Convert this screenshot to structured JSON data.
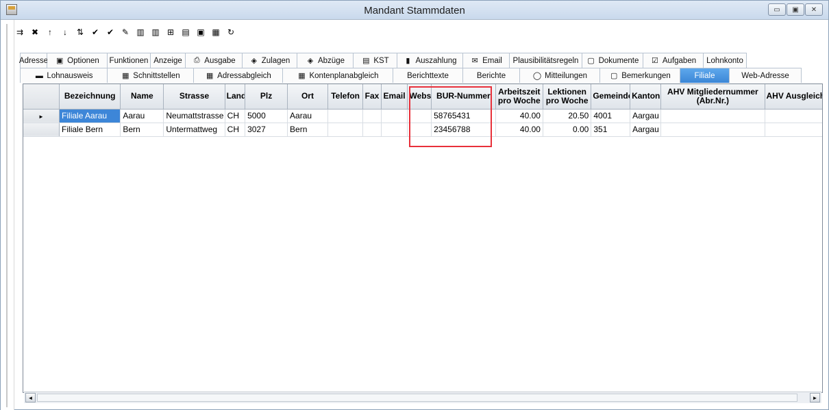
{
  "window": {
    "title": "Mandant Stammdaten"
  },
  "window_buttons": [
    "▭",
    "▣",
    "✕"
  ],
  "toolbar_icons": [
    {
      "name": "insert-row-icon",
      "glyph": "⇉"
    },
    {
      "name": "delete-row-icon",
      "glyph": "✖"
    },
    {
      "name": "arrow-up-icon",
      "glyph": "↑"
    },
    {
      "name": "arrow-down-icon",
      "glyph": "↓"
    },
    {
      "name": "sort-az-icon",
      "glyph": "⇅"
    },
    {
      "name": "spellcheck-icon",
      "glyph": "✔"
    },
    {
      "name": "spellcheck-all-icon",
      "glyph": "✔"
    },
    {
      "name": "edit-icon",
      "glyph": "✎"
    },
    {
      "name": "columns-icon",
      "glyph": "▥"
    },
    {
      "name": "columns2-icon",
      "glyph": "▥"
    },
    {
      "name": "merge-icon",
      "glyph": "⊞"
    },
    {
      "name": "import-icon",
      "glyph": "▤"
    },
    {
      "name": "save-icon",
      "glyph": "▣"
    },
    {
      "name": "copy-icon",
      "glyph": "▦"
    },
    {
      "name": "refresh-icon",
      "glyph": "↻"
    }
  ],
  "tabs_row1": [
    {
      "label": "Adresse",
      "icon": "",
      "w": 40
    },
    {
      "label": "Optionen",
      "icon": "▣",
      "w": 88
    },
    {
      "label": "Funktionen",
      "icon": "",
      "w": 63
    },
    {
      "label": "Anzeige",
      "icon": "",
      "w": 51
    },
    {
      "label": "Ausgabe",
      "icon": "⎙",
      "w": 83
    },
    {
      "label": "Zulagen",
      "icon": "◈",
      "w": 80
    },
    {
      "label": "Abzüge",
      "icon": "◈",
      "w": 82
    },
    {
      "label": "KST",
      "icon": "▤",
      "w": 64
    },
    {
      "label": "Auszahlung",
      "icon": "▮",
      "w": 96
    },
    {
      "label": "Email",
      "icon": "✉",
      "w": 68
    },
    {
      "label": "Plausibilitätsregeln",
      "icon": "",
      "w": 106
    },
    {
      "label": "Dokumente",
      "icon": "▢",
      "w": 89
    },
    {
      "label": "Aufgaben",
      "icon": "☑",
      "w": 88
    },
    {
      "label": "Lohnkonto",
      "icon": "",
      "w": 63
    }
  ],
  "tabs_row2": [
    {
      "label": "Lohnausweis",
      "icon": "▬",
      "w": 128
    },
    {
      "label": "Schnittstellen",
      "icon": "▦",
      "w": 126
    },
    {
      "label": "Adressabgleich",
      "icon": "▦",
      "w": 130
    },
    {
      "label": "Kontenplanabgleich",
      "icon": "▦",
      "w": 161
    },
    {
      "label": "Berichttexte",
      "icon": "",
      "w": 102
    },
    {
      "label": "Berichte",
      "icon": "",
      "w": 83
    },
    {
      "label": "Mitteilungen",
      "icon": "◯",
      "w": 117
    },
    {
      "label": "Bemerkungen",
      "icon": "▢",
      "w": 117
    },
    {
      "label": "Filiale",
      "icon": "",
      "w": 72,
      "active": true
    },
    {
      "label": "Web-Adresse",
      "icon": "",
      "w": 105
    }
  ],
  "columns": [
    {
      "label": "Bezeichnung",
      "w": 85
    },
    {
      "label": "Name",
      "w": 60
    },
    {
      "label": "Strasse",
      "w": 85
    },
    {
      "label": "Land",
      "w": 28
    },
    {
      "label": "Plz",
      "w": 59
    },
    {
      "label": "Ort",
      "w": 56
    },
    {
      "label": "Telefon",
      "w": 49
    },
    {
      "label": "Fax",
      "w": 25
    },
    {
      "label": "Email",
      "w": 37
    },
    {
      "label": "Website",
      "w": 33
    },
    {
      "label": "BUR-Nummer",
      "w": 89
    },
    {
      "label": "Arbeitszeit pro Woche",
      "w": 66,
      "twoline": true
    },
    {
      "label": "Lektionen pro Woche",
      "w": 67,
      "twoline": true
    },
    {
      "label": "Gemeindenummer",
      "w": 54
    },
    {
      "label": "Kanton",
      "w": 43
    },
    {
      "label": "AHV Mitgliedernummer (Abr.Nr.)",
      "w": 144,
      "twoline": true
    },
    {
      "label": "AHV Ausgleichskasse",
      "w": 86
    }
  ],
  "rows": [
    {
      "pointer": "►",
      "cells": [
        "Filiale Aarau",
        "Aarau",
        "Neumattstrasse",
        "CH",
        "5000",
        "Aarau",
        "",
        "",
        "",
        "",
        "58765431",
        "40.00",
        "20.50",
        "4001",
        "Aargau",
        "",
        ""
      ],
      "selected_first": true
    },
    {
      "pointer": "",
      "cells": [
        "Filiale Bern",
        "Bern",
        "Untermattweg",
        "CH",
        "3027",
        "Bern",
        "",
        "",
        "",
        "",
        "23456788",
        "40.00",
        "0.00",
        "351",
        "Aargau",
        "",
        ""
      ],
      "selected_first": false
    }
  ],
  "numeric_cols": [
    11,
    12
  ],
  "scroll": {
    "left": "◄",
    "right": "►"
  }
}
